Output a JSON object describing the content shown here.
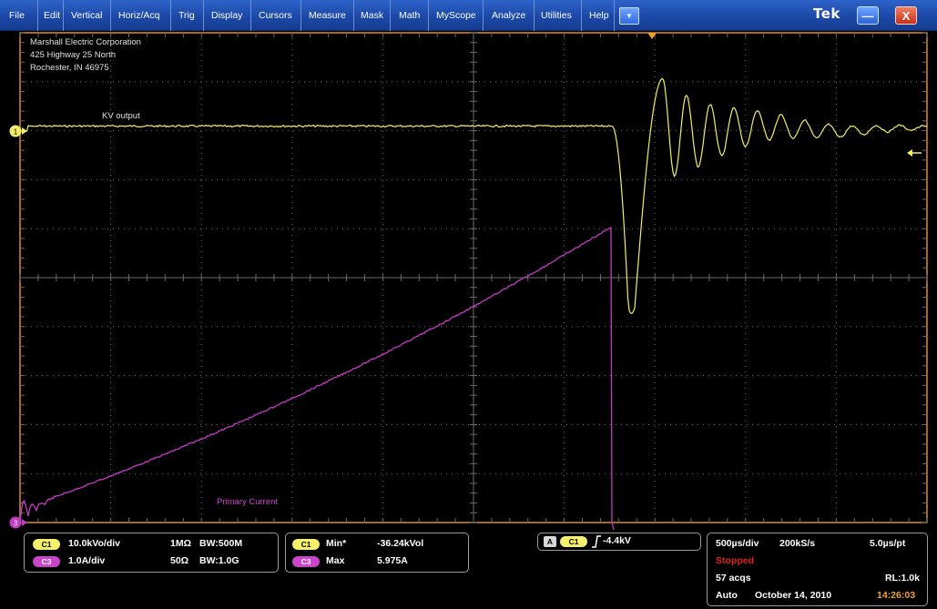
{
  "menu": {
    "items": [
      "File",
      "Edit",
      "Vertical",
      "Horiz/Acq",
      "Trig",
      "Display",
      "Cursors",
      "Measure",
      "Mask",
      "Math",
      "MyScope",
      "Analyze",
      "Utilities",
      "Help"
    ],
    "dropdown_glyph": "▼",
    "brand": "Tek",
    "minimize_glyph": "—",
    "close_glyph": "X"
  },
  "plot": {
    "company_line1": "Marshall Electric Corporation",
    "company_line2": "425 Highway 25 North",
    "company_line3": "Rochester, IN 46975",
    "ch1_label": "KV output",
    "ch3_label": "Primary Current",
    "ch1_marker": "1",
    "ch3_marker": "3",
    "ch1_color": "#f2ee6a",
    "ch3_color": "#c23cc2",
    "grid_color": "#6a6a6a",
    "trigger_marker_color": "#f0a030"
  },
  "readouts": {
    "ch1_badge": "C1",
    "ch3_badge": "C3",
    "ch1_scale": "10.0kVo/div",
    "ch3_scale": "1.0A/div",
    "ch1_impedance": "1MΩ",
    "ch3_impedance": "50Ω",
    "ch1_bw": "BW:500M",
    "ch3_bw": "BW:1.0G",
    "meas1_badge": "C1",
    "meas2_badge": "C3",
    "meas1_label": "Min*",
    "meas2_label": "Max",
    "meas1_value": "-36.24kVol",
    "meas2_value": "5.975A",
    "trig_mode_badge": "A",
    "trig_source_badge": "C1",
    "trig_level": "-4.4kV",
    "timebase": "500µs/div",
    "sample_rate": "200kS/s",
    "resolution": "5.0µs/pt",
    "run_state": "Stopped",
    "run_state_color": "#e02020",
    "acqs": "57 acqs",
    "record_length": "RL:1.0k",
    "trigger_mode": "Auto",
    "date": "October 14, 2010",
    "time": "14:26:03",
    "time_color": "#f0a030"
  }
}
